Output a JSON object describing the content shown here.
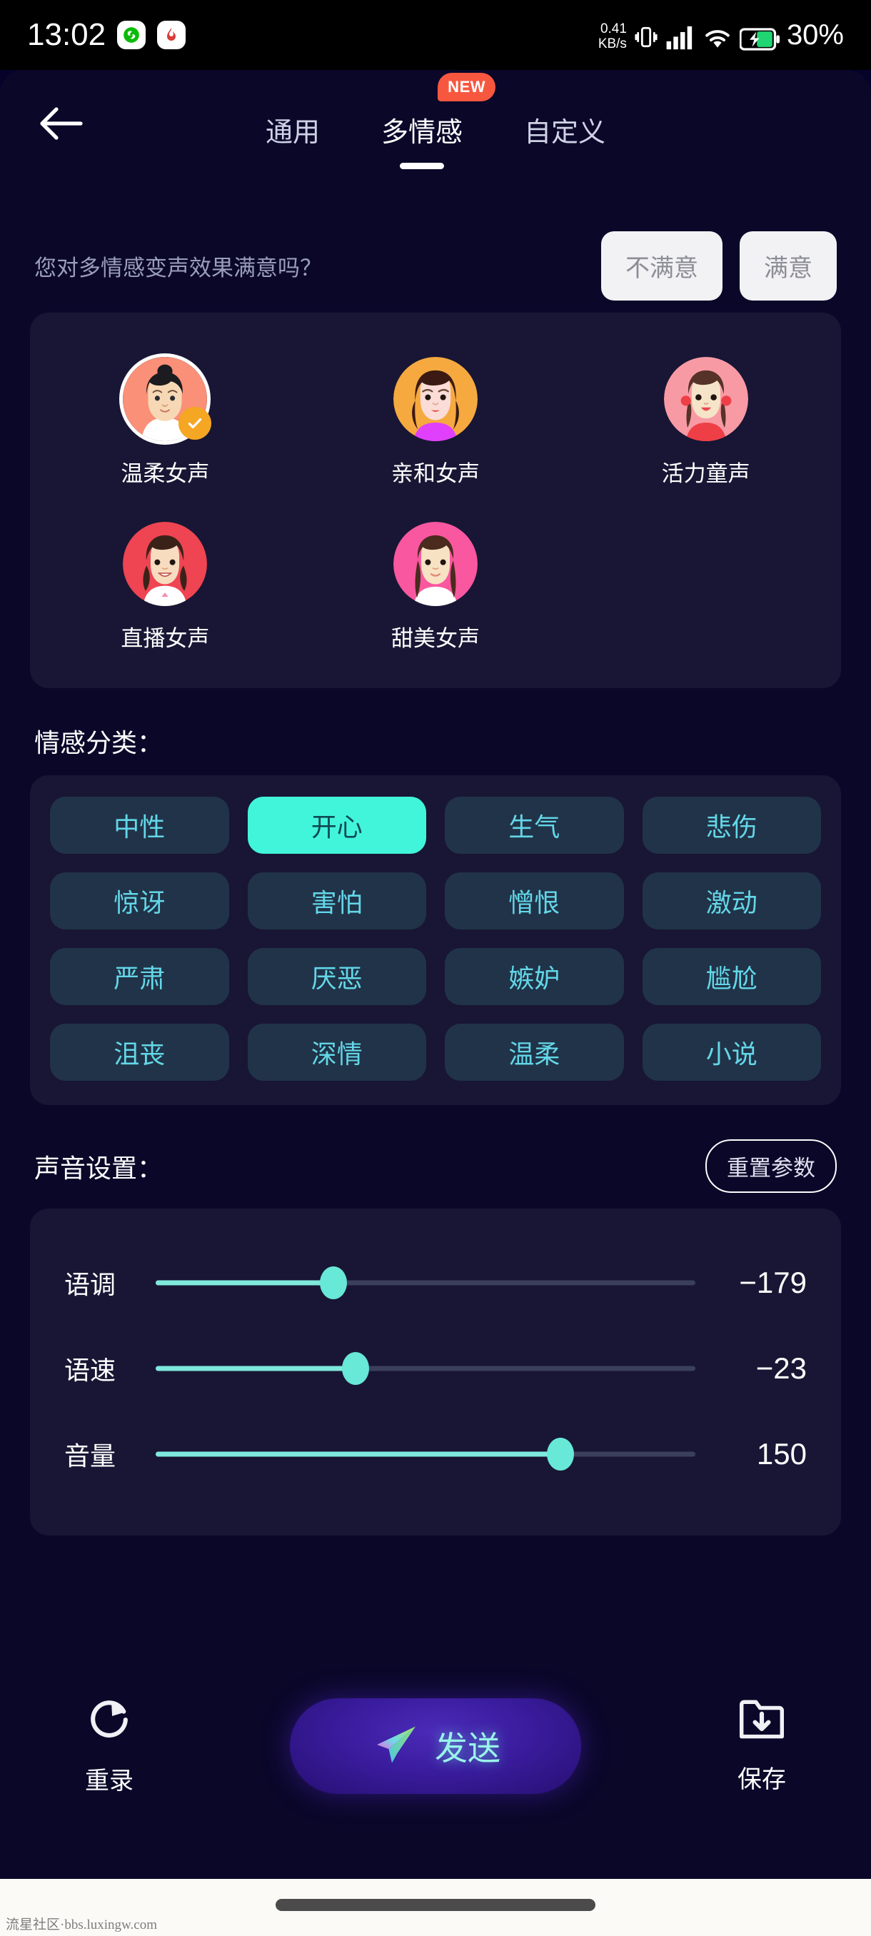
{
  "status_bar": {
    "time": "13:02",
    "apps": [
      {
        "name": "wechat-icon",
        "glyph": "◕"
      },
      {
        "name": "app-icon",
        "glyph": "❀"
      }
    ],
    "net_speed_value": "0.41",
    "net_speed_unit": "KB/s",
    "icons": [
      "vibrate-icon",
      "signal-icon",
      "wifi-icon",
      "battery-charging-icon"
    ],
    "battery": "30%"
  },
  "topbar": {
    "back_icon": "back-arrow-icon",
    "tabs": [
      {
        "label": "通用",
        "active": false,
        "badge": ""
      },
      {
        "label": "多情感",
        "active": true,
        "badge": "NEW"
      },
      {
        "label": "自定义",
        "active": false,
        "badge": ""
      }
    ]
  },
  "satisfaction": {
    "question": "您对多情感变声效果满意吗？",
    "dislike_label": "不满意",
    "like_label": "满意"
  },
  "voices": {
    "rows": [
      [
        {
          "label": "温柔女声",
          "selected": true,
          "ring": "#FA9077",
          "hair": "#1b1b20",
          "skin": "#f7d8b4",
          "cloth": "#ffffff"
        },
        {
          "label": "亲和女声",
          "selected": false,
          "ring": "#F5A93F",
          "hair": "#3a1a12",
          "skin": "#fbdcd6",
          "cloth": "#e040fb"
        },
        {
          "label": "活力童声",
          "selected": false,
          "ring": "#F89AA4",
          "hair": "#563228",
          "skin": "#f6e4c8",
          "cloth": "#ef3f46"
        }
      ],
      [
        {
          "label": "直播女声",
          "selected": false,
          "ring": "#EF4452",
          "hair": "#3b2219",
          "skin": "#f7dcc0",
          "cloth": "#ffffff"
        },
        {
          "label": "甜美女声",
          "selected": false,
          "ring": "#F9579F",
          "hair": "#4a2b1e",
          "skin": "#f8e2c4",
          "cloth": "#ffffff"
        }
      ]
    ],
    "selected_badge_icon": "check-icon"
  },
  "emotion": {
    "section_title": "情感分类：",
    "rows": [
      [
        {
          "label": "中性",
          "active": false
        },
        {
          "label": "开心",
          "active": true
        },
        {
          "label": "生气",
          "active": false
        },
        {
          "label": "悲伤",
          "active": false
        }
      ],
      [
        {
          "label": "惊讶",
          "active": false
        },
        {
          "label": "害怕",
          "active": false
        },
        {
          "label": "憎恨",
          "active": false
        },
        {
          "label": "激动",
          "active": false
        }
      ],
      [
        {
          "label": "严肃",
          "active": false
        },
        {
          "label": "厌恶",
          "active": false
        },
        {
          "label": "嫉妒",
          "active": false
        },
        {
          "label": "尴尬",
          "active": false
        }
      ],
      [
        {
          "label": "沮丧",
          "active": false
        },
        {
          "label": "深情",
          "active": false
        },
        {
          "label": "温柔",
          "active": false
        },
        {
          "label": "小说",
          "active": false
        }
      ]
    ]
  },
  "sound_settings": {
    "section_title": "声音设置：",
    "reset_label": "重置参数",
    "sliders": [
      {
        "label": "语调",
        "value": "−179",
        "percent": 33
      },
      {
        "label": "语速",
        "value": "−23",
        "percent": 37
      },
      {
        "label": "音量",
        "value": "150",
        "percent": 75
      }
    ]
  },
  "actions": {
    "rerecord": {
      "icon": "refresh-icon",
      "label": "重录"
    },
    "send": {
      "icon": "paper-plane-icon",
      "label": "发送"
    },
    "save": {
      "icon": "folder-download-icon",
      "label": "保存"
    }
  },
  "watermark": "流星社区·bbs.luxingw.com",
  "colors": {
    "background": "#0a0729",
    "panel": "#181634",
    "accent_cyan": "#41f5db",
    "chip_bg": "#213348",
    "chip_text": "#63d7e8",
    "badge_red": "#f8573f",
    "check_orange": "#f5a623"
  }
}
